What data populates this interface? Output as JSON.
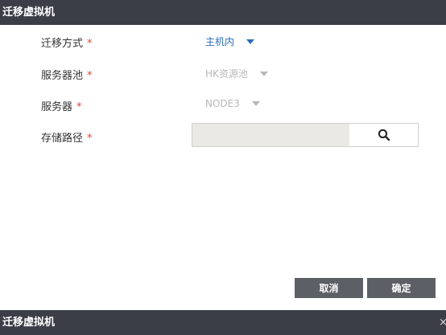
{
  "dialog": {
    "title": "迁移虚拟机",
    "close_glyph": "×"
  },
  "form": {
    "migrate_mode": {
      "label": "迁移方式",
      "required_mark": "*",
      "value": "主机内"
    },
    "server_pool": {
      "label": "服务器池",
      "required_mark": "*",
      "value": "HK资源池"
    },
    "server": {
      "label": "服务器",
      "required_mark": "*",
      "value": "NODE3"
    },
    "storage_path": {
      "label": "存储路径",
      "required_mark": "*",
      "value": "",
      "placeholder": ""
    }
  },
  "buttons": {
    "cancel_label": "取消",
    "ok_label": "确定"
  },
  "next_dialog": {
    "title": "迁移虚拟机"
  },
  "colors": {
    "titlebar_bg": "#3b3e47",
    "accent_blue": "#2b6cb8",
    "required_red": "#e0433d",
    "button_bg": "#5c5f65",
    "disabled_text": "#b8b8b8"
  },
  "icons": {
    "dropdown": "caret-down-icon",
    "search": "search-icon",
    "close": "close-icon"
  }
}
